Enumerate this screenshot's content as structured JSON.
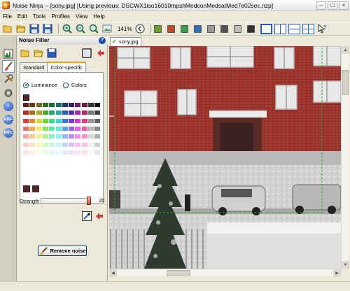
{
  "window": {
    "title": "Noise Ninja -- [sony.jpg] [Using previous: DSCWX1iso16010mpshMedconMedsatMed7e02sec.nzp]",
    "minimize": "–",
    "maximize": "□",
    "close": "×"
  },
  "menu": [
    "File",
    "Edit",
    "Tools",
    "Profiles",
    "View",
    "Help"
  ],
  "toolbar": {
    "zoom": "141%",
    "color_swatches": [
      "#6b9e2f",
      "#c24a2c",
      "#3aa047",
      "#2f6fc0",
      "#9a9a9a",
      "#555555",
      "#bdbdbd",
      "#333333"
    ]
  },
  "panel": {
    "title": "Noise Filter",
    "help": "?",
    "tabs": [
      "Standard",
      "Color-specific"
    ],
    "active_tab": "Color-specific",
    "radio_luminance": "Luminance",
    "radio_colors": "Colors",
    "selected_radio": "Luminance",
    "strength_label": "Strength",
    "strength_value": "20",
    "strength_level": 1.0,
    "remove_button": "Remove noise"
  },
  "image_tab": "sony.jpg",
  "sidebar_icons": [
    "histogram-icon",
    "brush-icon",
    "tools-icon",
    "settings-icon",
    "info-icon",
    "exif-icon",
    "iptc-icon"
  ],
  "sidebar_labels": {
    "exif": "EXIF",
    "iptc": "IPTC"
  },
  "accent": "#2a5fb5"
}
